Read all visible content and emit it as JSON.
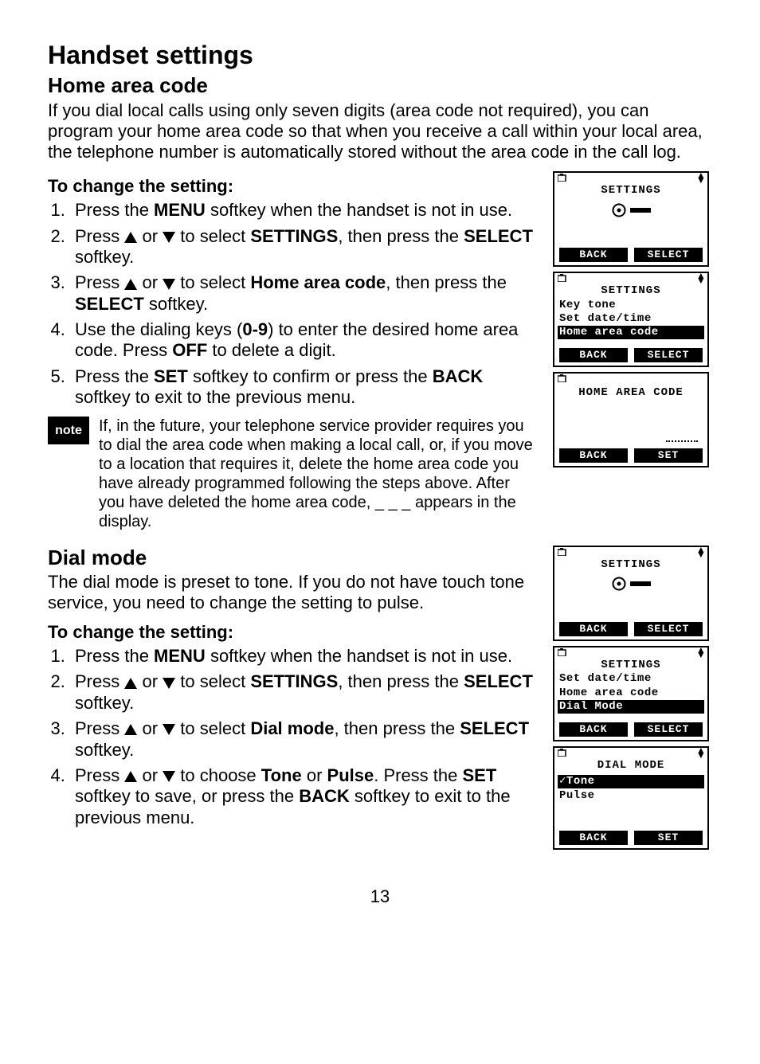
{
  "page": {
    "title": "Handset settings",
    "section1": {
      "heading": "Home area code",
      "intro": "If you dial local calls using only seven digits (area code not required), you can program your home area code so that when you receive a call within your local area, the telephone number is automatically stored without the area code in the call log.",
      "sub": "To change the setting:",
      "steps": {
        "s1a": "Press the ",
        "s1b": "MENU",
        "s1c": " softkey when the handset is not in use.",
        "s2a": "Press ",
        "s2b": " or ",
        "s2c": " to select ",
        "s2d": "SETTINGS",
        "s2e": ", then press the ",
        "s2f": "SELECT",
        "s2g": " softkey.",
        "s3a": "Press ",
        "s3b": " or ",
        "s3c": " to select ",
        "s3d": "Home area code",
        "s3e": ", then press the ",
        "s3f": "SELECT",
        "s3g": " softkey.",
        "s4a": "Use the dialing keys (",
        "s4b": "0-9",
        "s4c": ") to enter the desired home area code. Press ",
        "s4d": "OFF",
        "s4e": " to delete a digit.",
        "s5a": "Press the ",
        "s5b": "SET",
        "s5c": " softkey to confirm or press the ",
        "s5d": "BACK",
        "s5e": " softkey to exit to the previous menu."
      },
      "note_label": "note",
      "note_text": "If, in the future, your telephone service provider requires you to dial the area code when making a local call, or, if you move to a location that requires it, delete the home area code you have already programmed following the steps above. After you have deleted the home area code, _ _ _ appears in the display."
    },
    "section2": {
      "heading": "Dial mode",
      "intro": "The dial mode is preset to tone. If you do not have touch tone service, you need to change the setting to pulse.",
      "sub": "To change the setting:",
      "steps": {
        "s1a": "Press the ",
        "s1b": "MENU",
        "s1c": " softkey when the handset is not in use.",
        "s2a": "Press ",
        "s2b": " or ",
        "s2c": " to select ",
        "s2d": "SETTINGS",
        "s2e": ", then press the ",
        "s2f": "SELECT",
        "s2g": " softkey.",
        "s3a": "Press ",
        "s3b": " or ",
        "s3c": " to select ",
        "s3d": "Dial mode",
        "s3e": ", then press the ",
        "s3f": "SELECT",
        "s3g": " softkey.",
        "s4a": "Press ",
        "s4b": " or ",
        "s4c": " to choose ",
        "s4d": "Tone",
        "s4e": " or ",
        "s4f": "Pulse",
        "s4g": ". Press the ",
        "s4h": "SET",
        "s4i": " softkey to save, or press the ",
        "s4j": "BACK",
        "s4k": " softkey to exit to the previous menu."
      }
    },
    "page_number": "13"
  },
  "lcd": {
    "settings_title": "SETTINGS",
    "back": "BACK",
    "select": "SELECT",
    "set": "SET",
    "scr2": {
      "l1": "Key tone",
      "l2": "Set date/time",
      "l3": "Home area code"
    },
    "scr3_title": "HOME AREA CODE",
    "scr5": {
      "l1": "Set date/time",
      "l2": "Home area code",
      "l3": "Dial Mode"
    },
    "scr6": {
      "title": "DIAL MODE",
      "l1": "✓Tone",
      "l2": " Pulse"
    }
  }
}
